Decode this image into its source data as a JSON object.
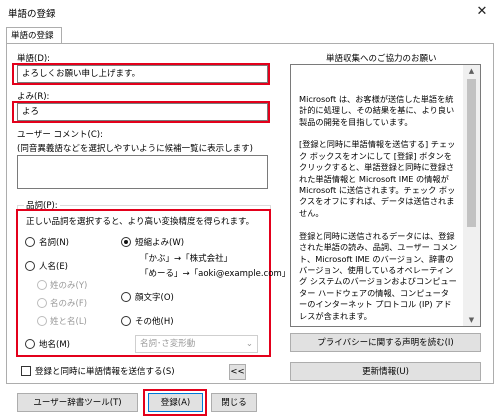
{
  "window": {
    "title": "単語の登録",
    "close_glyph": "✕"
  },
  "tab": {
    "label": "単語の登録"
  },
  "word": {
    "label": "単語(D):",
    "value": "よろしくお願い申し上げます。"
  },
  "reading": {
    "label": "よみ(R):",
    "value": "よろ"
  },
  "comment": {
    "label": "ユーザー コメント(C):",
    "hint": "(同音異義語などを選択しやすいように候補一覧に表示します)",
    "value": ""
  },
  "pos": {
    "group_label": "品詞(P):",
    "hint": "正しい品詞を選択すると、より高い変換精度を得られます。",
    "noun": "名詞(N)",
    "person": "人名(E)",
    "person_sub": [
      "姓のみ(Y)",
      "名のみ(F)",
      "姓と名(L)"
    ],
    "short": "短縮よみ(W)",
    "short_ex1": "「かぶ」→「株式会社」",
    "short_ex2": "「めーる」→「aoki@example.com」",
    "emoticon": "顔文字(O)",
    "other": "その他(H)",
    "place": "地名(M)",
    "select_value": "名詞･さ変形動",
    "selected": "short"
  },
  "send": {
    "label": "登録と同時に単語情報を送信する(S)",
    "checked": false,
    "collapse": "<<"
  },
  "right": {
    "title": "単語収集へのご協力のお願い",
    "notice": "Microsoft は、お客様が送信した単語を統計的に処理し、その結果を基に、より良い製品の開発を目指しています。\n\n[登録と同時に単語情報を送信する] チェック ボックスをオンにして [登録] ボタンをクリックすると、単語登録と同時に登録された単語情報と Microsoft IME の情報が Microsoft に送信されます。チェック ボックスをオフにすれば、データは送信されません。\n\n登録と同時に送信されるデータには、登録された単語の読み、品詞、ユーザー コメント、Microsoft IME のバージョン、辞書のバージョン、使用しているオペレーティング システムのバージョンおよびコンピューター ハードウェアの情報、コンピューターのインターネット プロトコル (IP) アドレスが含まれます。\n\nお客様特有の情報が収集されたデータに含まれることがあります。このような情報が存在する場合でも、Microsoft では、お客様を特定するために使用することはありません。",
    "privacy_button": "プライバシーに関する声明を読む(I)",
    "update_button": "更新情報(U)"
  },
  "buttons": {
    "dictionary_tool": "ユーザー辞書ツール(T)",
    "register": "登録(A)",
    "close": "閉じる"
  }
}
